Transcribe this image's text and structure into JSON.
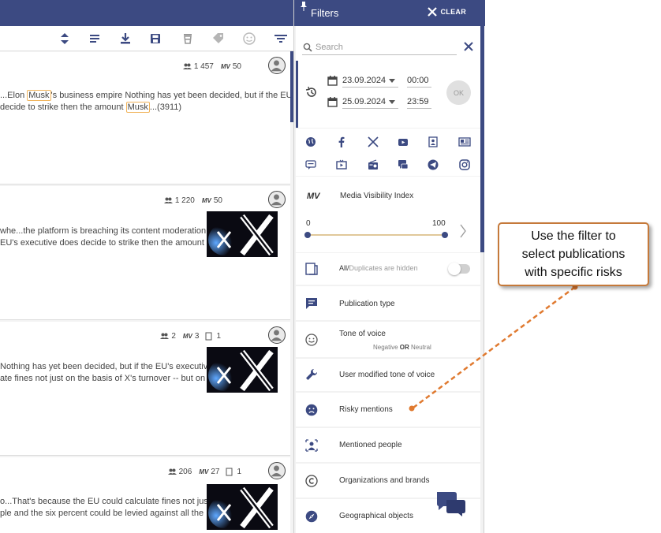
{
  "feed": {
    "cards": [
      {
        "reach": "1 457",
        "mv": "50",
        "lines": [
          [
            "...Elon ",
            "Musk",
            "'s business empire Nothing has yet been decided, but if the EU's"
          ],
          [
            "decide to strike then the amount ",
            "Musk",
            "...(3911)"
          ]
        ]
      },
      {
        "reach": "1 220",
        "mv": "50",
        "lines": [
          [
            "whe...the platform is breaching its content moderation"
          ],
          [
            "EU's executive does decide to strike then the amount"
          ]
        ]
      },
      {
        "reach": "2",
        "mv": "3",
        "dup": "1",
        "lines": [
          [
            "Nothing has yet been decided, but if the EU's executive"
          ],
          [
            "ate fines not just on the basis of X's turnover -- but on"
          ]
        ]
      },
      {
        "reach": "206",
        "mv": "27",
        "dup": "1",
        "lines": [
          [
            "o...That's because the EU could calculate fines not just"
          ],
          [
            "ple and the six percent could be levied against all the"
          ]
        ]
      }
    ],
    "mv_label": "MV"
  },
  "panel": {
    "title": "Filters",
    "clear_label": "CLEAR",
    "search_placeholder": "Search",
    "date_from": "23.09.2024",
    "time_from": "00:00",
    "date_to": "25.09.2024",
    "time_to": "23:59",
    "ok_label": "OK",
    "sources": [
      "globe-icon",
      "facebook-icon",
      "x-icon",
      "youtube-icon",
      "blog-icon",
      "news-icon",
      "forum-icon",
      "tv-icon",
      "radio-icon",
      "chat-icon",
      "telegram-icon",
      "instagram-icon"
    ],
    "mv": {
      "logo": "MV",
      "title": "Media Visibility Index",
      "min": "0",
      "max": "100",
      "value_low": 0,
      "value_high": 100
    },
    "duplicates": {
      "label_strong": "All/",
      "label_rest": "Duplicates are hidden",
      "enabled": false
    },
    "rows": [
      {
        "label": "Publication type",
        "icon": "message-icon"
      },
      {
        "label": "Tone of voice",
        "sub_a": "Negative ",
        "sub_or": "OR",
        "sub_b": " Neutral",
        "icon": "smiley-icon"
      },
      {
        "label": "User modified tone of voice",
        "icon": "wrench-icon"
      },
      {
        "label": "Risky mentions",
        "icon": "sad-face-icon"
      },
      {
        "label": "Mentioned people",
        "icon": "person-icon"
      },
      {
        "label": "Organizations and brands",
        "icon": "copyright-icon"
      },
      {
        "label": "Geographical objects",
        "icon": "compass-icon"
      }
    ]
  },
  "callout": {
    "text": "Use the filter to\nselect publications\nwith specific risks"
  },
  "colors": {
    "brand": "#3c4a82",
    "callout_border": "#c5793a",
    "highlight": "#f0b35a"
  }
}
